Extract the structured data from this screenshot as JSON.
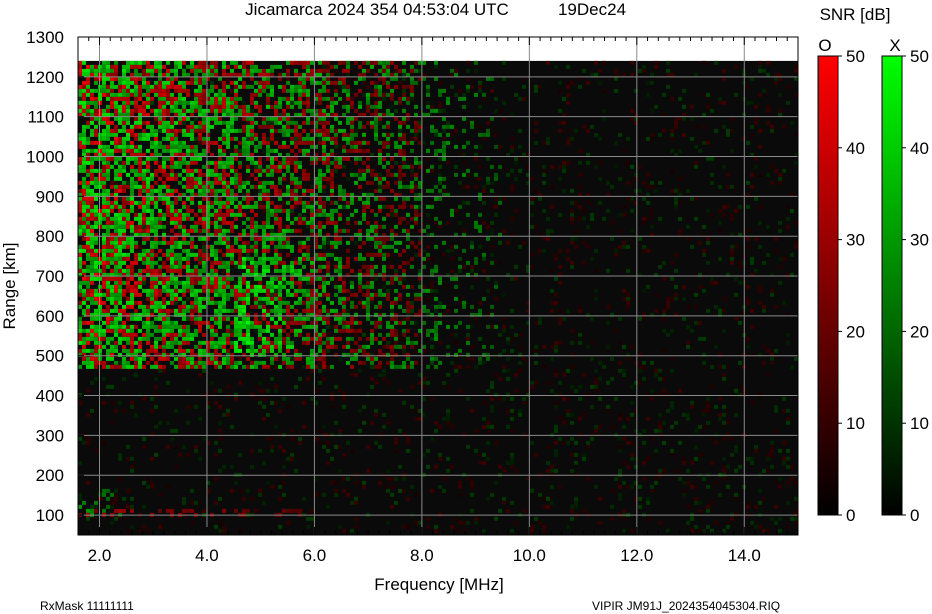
{
  "chart_data": {
    "type": "heatmap",
    "title": "Jicamarca 2024 354 04:53:04 UTC",
    "date": "19Dec24",
    "xlabel": "Frequency [MHz]",
    "ylabel": "Range [km]",
    "xlim": [
      1.6,
      15.0
    ],
    "ylim": [
      50,
      1300
    ],
    "xticks": [
      2.0,
      4.0,
      6.0,
      8.0,
      10.0,
      12.0,
      14.0
    ],
    "xtick_labels": [
      "2.0",
      "4.0",
      "6.0",
      "8.0",
      "10.0",
      "12.0",
      "14.0"
    ],
    "yticks": [
      100,
      200,
      300,
      400,
      500,
      600,
      700,
      800,
      900,
      1000,
      1100,
      1200,
      1300
    ],
    "grid": true,
    "data_range_top_km": 1240,
    "colorbar": {
      "title": "SNR [dB]",
      "range": [
        0,
        50
      ],
      "ticks": [
        0,
        10,
        20,
        30,
        40,
        50
      ],
      "channels": [
        {
          "name": "O",
          "color": "#ff0000"
        },
        {
          "name": "X",
          "color": "#00ff00"
        }
      ]
    },
    "echo_regions": [
      {
        "channel": "X",
        "freq": [
          1.6,
          9.5
        ],
        "range": [
          470,
          1240
        ],
        "peak_db": 45
      },
      {
        "channel": "O",
        "freq": [
          1.6,
          8.0
        ],
        "range": [
          470,
          1240
        ],
        "peak_db": 45
      },
      {
        "channel": "X",
        "freq": [
          4.5,
          7.0
        ],
        "range": [
          500,
          750
        ],
        "peak_db": 50
      },
      {
        "channel": "O",
        "freq": [
          1.6,
          2.6
        ],
        "range": [
          490,
          600
        ],
        "peak_db": 48
      },
      {
        "channel": "X",
        "freq": [
          1.6,
          2.5
        ],
        "range": [
          100,
          170
        ],
        "peak_db": 30
      },
      {
        "channel": "O",
        "freq": [
          1.6,
          6.0
        ],
        "range": [
          100,
          115
        ],
        "peak_db": 30
      }
    ]
  },
  "footer": {
    "left": "RxMask 11111111",
    "right": "VIPIR  JM91J_2024354045304.RIQ"
  }
}
